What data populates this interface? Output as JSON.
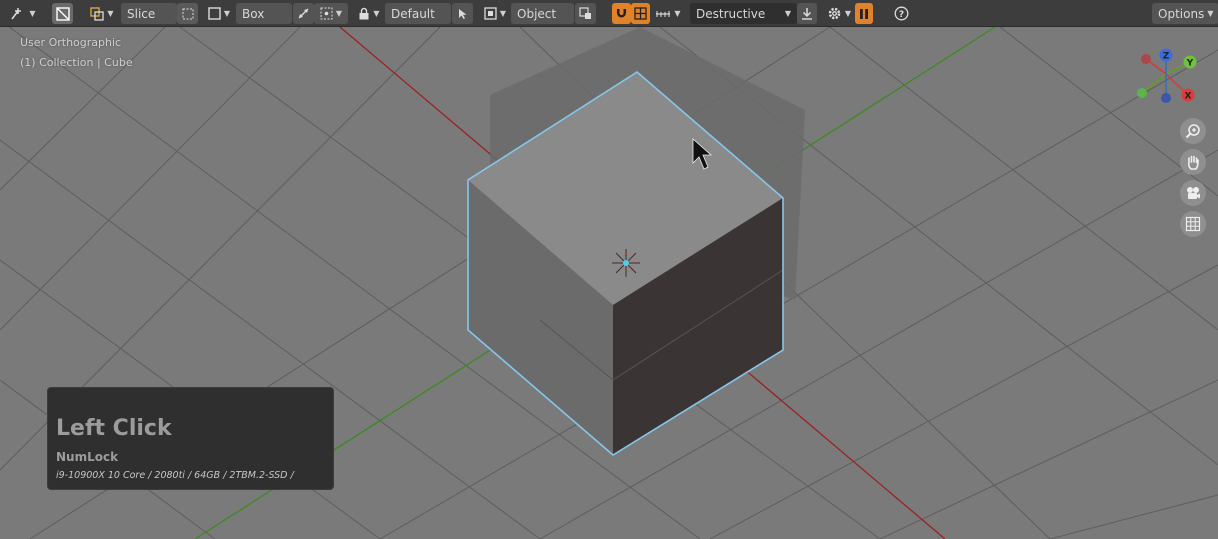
{
  "header": {
    "cut_mode": "Slice",
    "shape": "Box",
    "orientation": "Default",
    "pivot": "Object",
    "boolean_mode": "Destructive",
    "options_label": "Options"
  },
  "viewport": {
    "view_name": "User Orthographic",
    "collection_label": "(1) Collection | Cube"
  },
  "gizmo": {
    "axis_labels": {
      "x": "X",
      "y": "Y",
      "z": "Z"
    },
    "colors": {
      "x": "#d63a3a",
      "y": "#5fa318",
      "z": "#2c6fd1"
    }
  },
  "key_overlay": {
    "main": "Left Click",
    "modifier": "NumLock",
    "system_specs": "i9-10900X 10 Core / 2080ti / 64GB / 2TBM.2-SSD /"
  },
  "colors": {
    "selection_outline": "#86c6ea",
    "active_toggle": "#e0822a",
    "x_axis_line": "#9b2222",
    "y_axis_line": "#3b8a22"
  }
}
